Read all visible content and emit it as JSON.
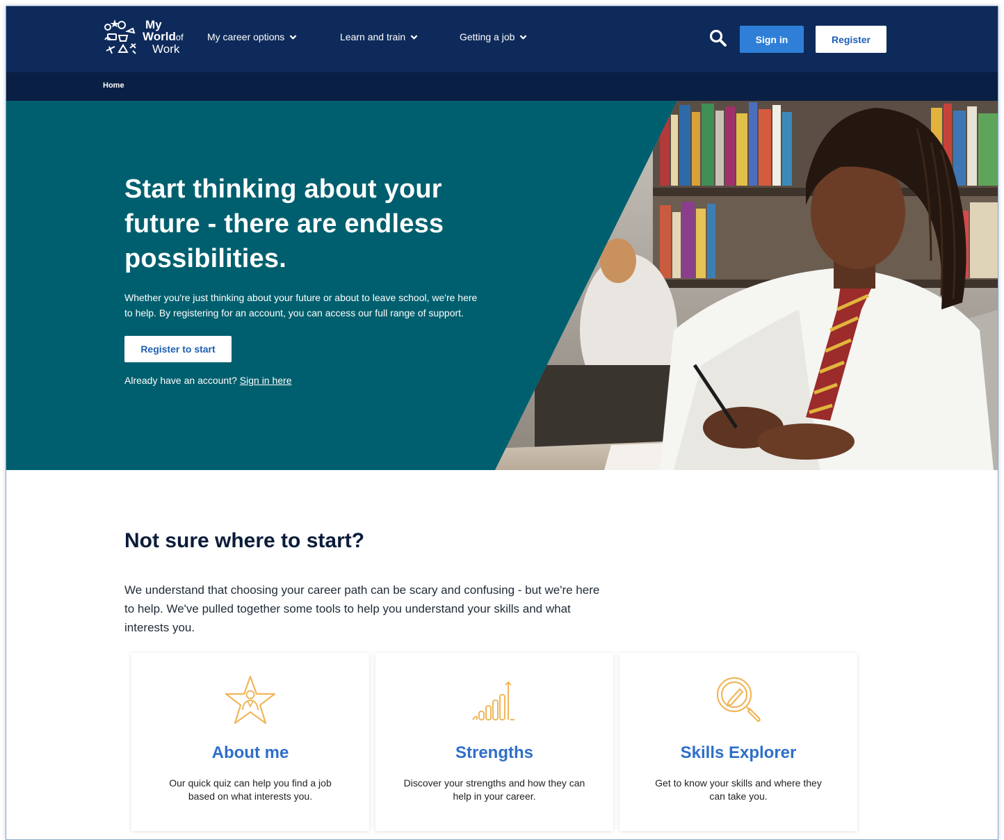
{
  "header": {
    "logo": {
      "line1": "My",
      "line2": "World",
      "line2_small": "of",
      "line3": "Work"
    },
    "nav": [
      {
        "label": "My career options"
      },
      {
        "label": "Learn and train"
      },
      {
        "label": "Getting a job"
      }
    ],
    "signin_label": "Sign in",
    "register_label": "Register"
  },
  "breadcrumb": {
    "home": "Home"
  },
  "hero": {
    "title": "Start thinking about your future - there are endless possibilities.",
    "body": "Whether you're just thinking about your future or about to leave school, we're here to help. By registering for an account, you can access our full range of support.",
    "cta_label": "Register to start",
    "already_text": "Already have an account?",
    "signin_link": "Sign in here"
  },
  "section": {
    "title": "Not sure where to start?",
    "body": "We understand that choosing your career path can be scary and confusing - but we're here to help. We've pulled together some tools to help you understand your skills and what interests you."
  },
  "cards": [
    {
      "title": "About me",
      "desc": "Our quick quiz can help you find a job based on what interests you.",
      "icon": "star-person-icon"
    },
    {
      "title": "Strengths",
      "desc": "Discover your strengths and how they can help in your career.",
      "icon": "bar-chart-icon"
    },
    {
      "title": "Skills Explorer",
      "desc": "Get to know your skills and where they can take you.",
      "icon": "magnifier-pencil-icon"
    }
  ],
  "colors": {
    "navy": "#0e2a5a",
    "breadcrumb": "#0a1f44",
    "teal": "#005f6e",
    "blue_button": "#2f7fd8",
    "card_title": "#2f6fc8",
    "icon_gold": "#f0b65a"
  }
}
